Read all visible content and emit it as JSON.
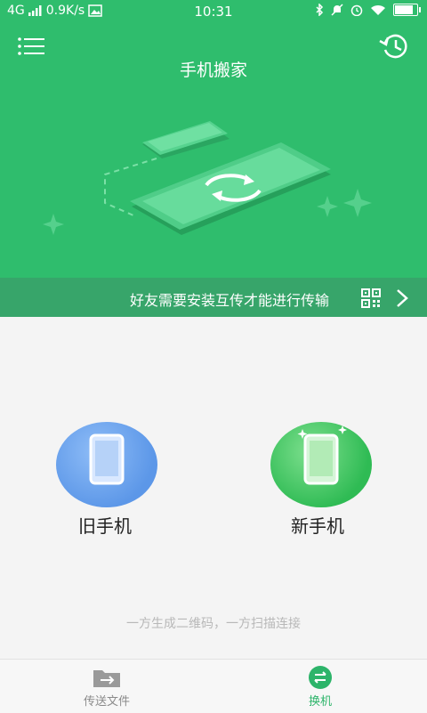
{
  "status_bar": {
    "network": "4G",
    "speed": "0.9K/s",
    "time": "10:31",
    "battery_level": 0.85
  },
  "header": {
    "title": "手机搬家",
    "banner_text": "好友需要安装互传才能进行传输"
  },
  "devices": {
    "old_label": "旧手机",
    "new_label": "新手机"
  },
  "hint": "一方生成二维码，一方扫描连接",
  "tabs": [
    {
      "label": "传送文件",
      "active": false
    },
    {
      "label": "换机",
      "active": true
    }
  ],
  "colors": {
    "brand_green": "#2fbd6d",
    "banner_green": "#37a56a",
    "tab_active": "#2db46a",
    "tab_inactive": "#8a8a8a"
  },
  "icons": {
    "menu": "menu-icon",
    "history": "history-icon",
    "qr": "qr-code-icon",
    "chevron": "chevron-right-icon",
    "swap": "swap-icon"
  }
}
